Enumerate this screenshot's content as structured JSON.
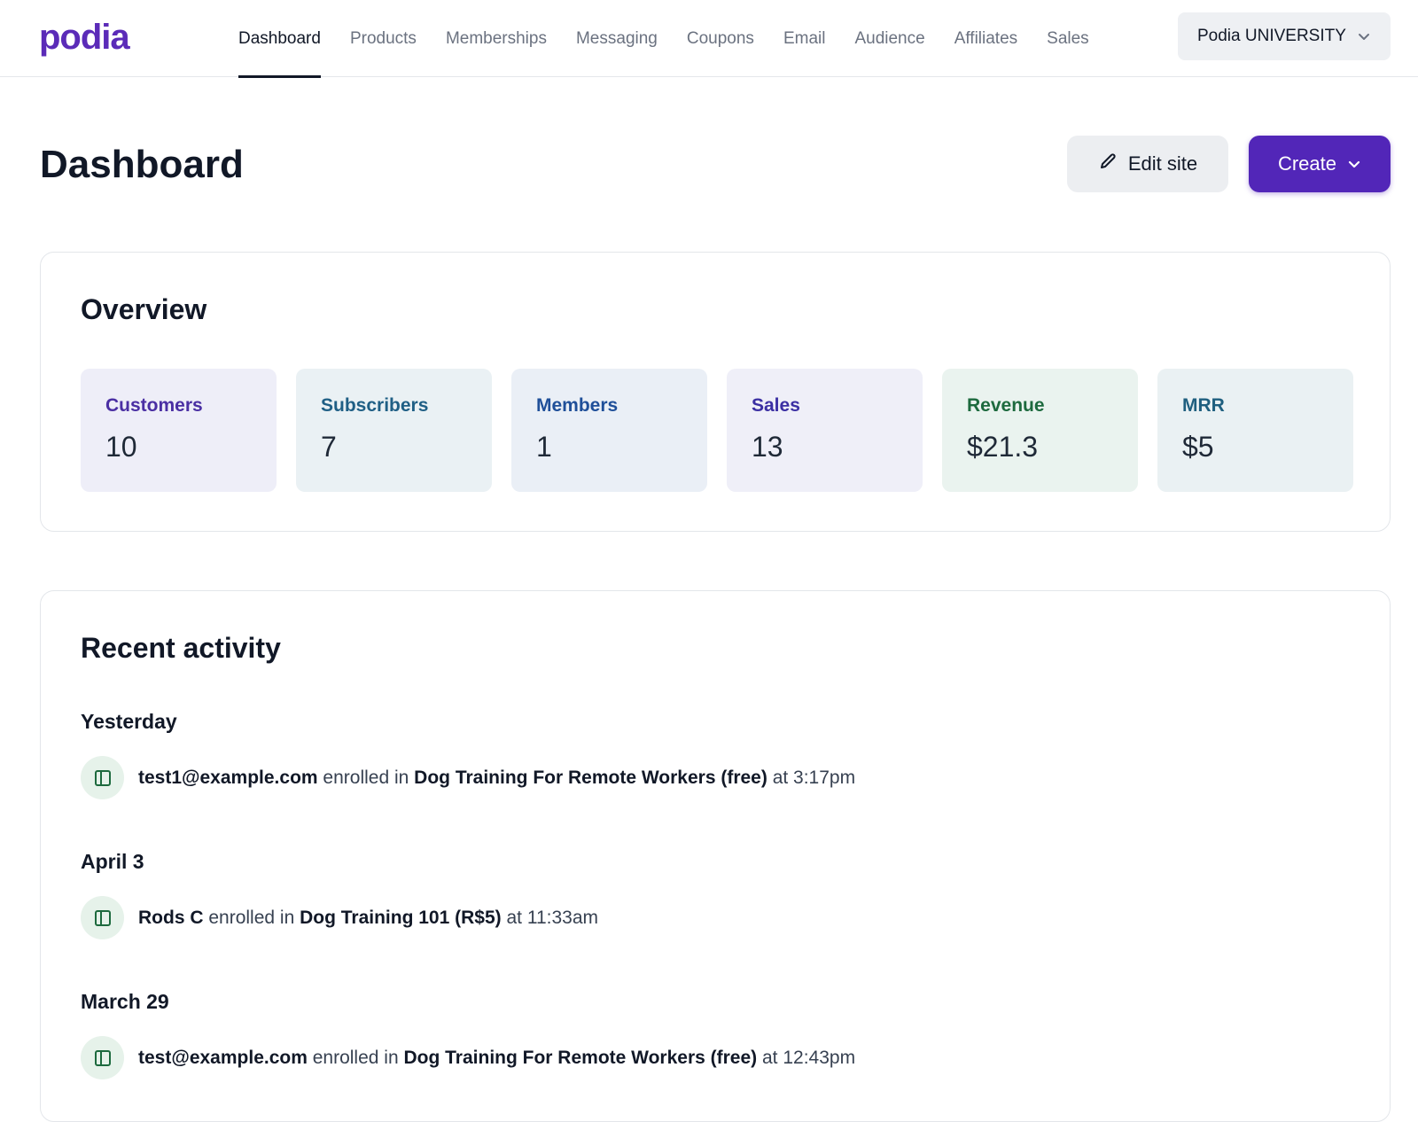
{
  "brand": {
    "logo": "podia",
    "accent": "#5226b8"
  },
  "nav": {
    "items": [
      "Dashboard",
      "Products",
      "Memberships",
      "Messaging",
      "Coupons",
      "Email",
      "Audience",
      "Affiliates",
      "Sales"
    ],
    "active": "Dashboard",
    "site_switcher": "Podia UNIVERSITY"
  },
  "page": {
    "title": "Dashboard",
    "edit_label": "Edit site",
    "create_label": "Create"
  },
  "overview": {
    "title": "Overview",
    "stats": [
      {
        "label": "Customers",
        "value": "10",
        "bg": "#eeeef8",
        "color": "#4a2fa3"
      },
      {
        "label": "Subscribers",
        "value": "7",
        "bg": "#eaf1f4",
        "color": "#1f5f85"
      },
      {
        "label": "Members",
        "value": "1",
        "bg": "#eaeff6",
        "color": "#1f4f99"
      },
      {
        "label": "Sales",
        "value": "13",
        "bg": "#efeff8",
        "color": "#3b2fa3"
      },
      {
        "label": "Revenue",
        "value": "$21.3",
        "bg": "#eaf3ef",
        "color": "#1d6a3e"
      },
      {
        "label": "MRR",
        "value": "$5",
        "bg": "#eaf1f3",
        "color": "#1f5f7f"
      }
    ]
  },
  "activity": {
    "title": "Recent activity",
    "groups": [
      {
        "day": "Yesterday",
        "who": "test1@example.com",
        "verb": "enrolled in",
        "product": "Dog Training For Remote Workers (free)",
        "time": "at 3:17pm"
      },
      {
        "day": "April 3",
        "who": "Rods C",
        "verb": "enrolled in",
        "product": "Dog Training 101 (R$5)",
        "time": "at 11:33am"
      },
      {
        "day": "March 29",
        "who": "test@example.com",
        "verb": "enrolled in",
        "product": "Dog Training For Remote Workers (free)",
        "time": "at 12:43pm"
      }
    ]
  }
}
